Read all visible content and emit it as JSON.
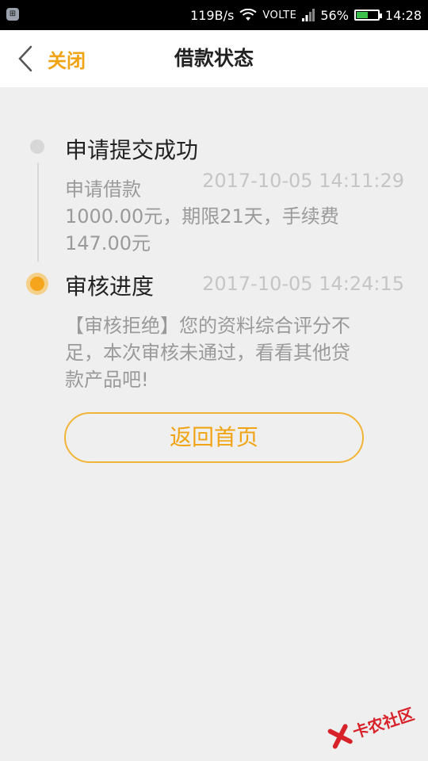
{
  "status_bar": {
    "app_icon_glyph": "⊞",
    "net_speed": "119B/s",
    "network": "VOLTE",
    "battery_percent_text": "56%",
    "battery_level": 0.56,
    "time": "14:28",
    "battery_color": "#3cc24a"
  },
  "header": {
    "back_label": "关闭",
    "title": "借款状态",
    "accent_color": "#f0a414"
  },
  "timeline": [
    {
      "title": "申请提交成功",
      "time": "2017-10-05 14:11:29",
      "desc_line1": "申请借款",
      "desc_line2": "1000.00元，期限21天，手续费",
      "desc_line3": "147.00元",
      "status": "done"
    },
    {
      "title": "审核进度",
      "time": "2017-10-05 14:24:15",
      "desc_line1": "【审核拒绝】您的资料综合评分不",
      "desc_line2": "足，本次审核未通过，看看其他贷",
      "desc_line3": "款产品吧!",
      "status": "current"
    }
  ],
  "actions": {
    "home_button": "返回首页"
  },
  "watermark": {
    "text": "卡农社区"
  }
}
